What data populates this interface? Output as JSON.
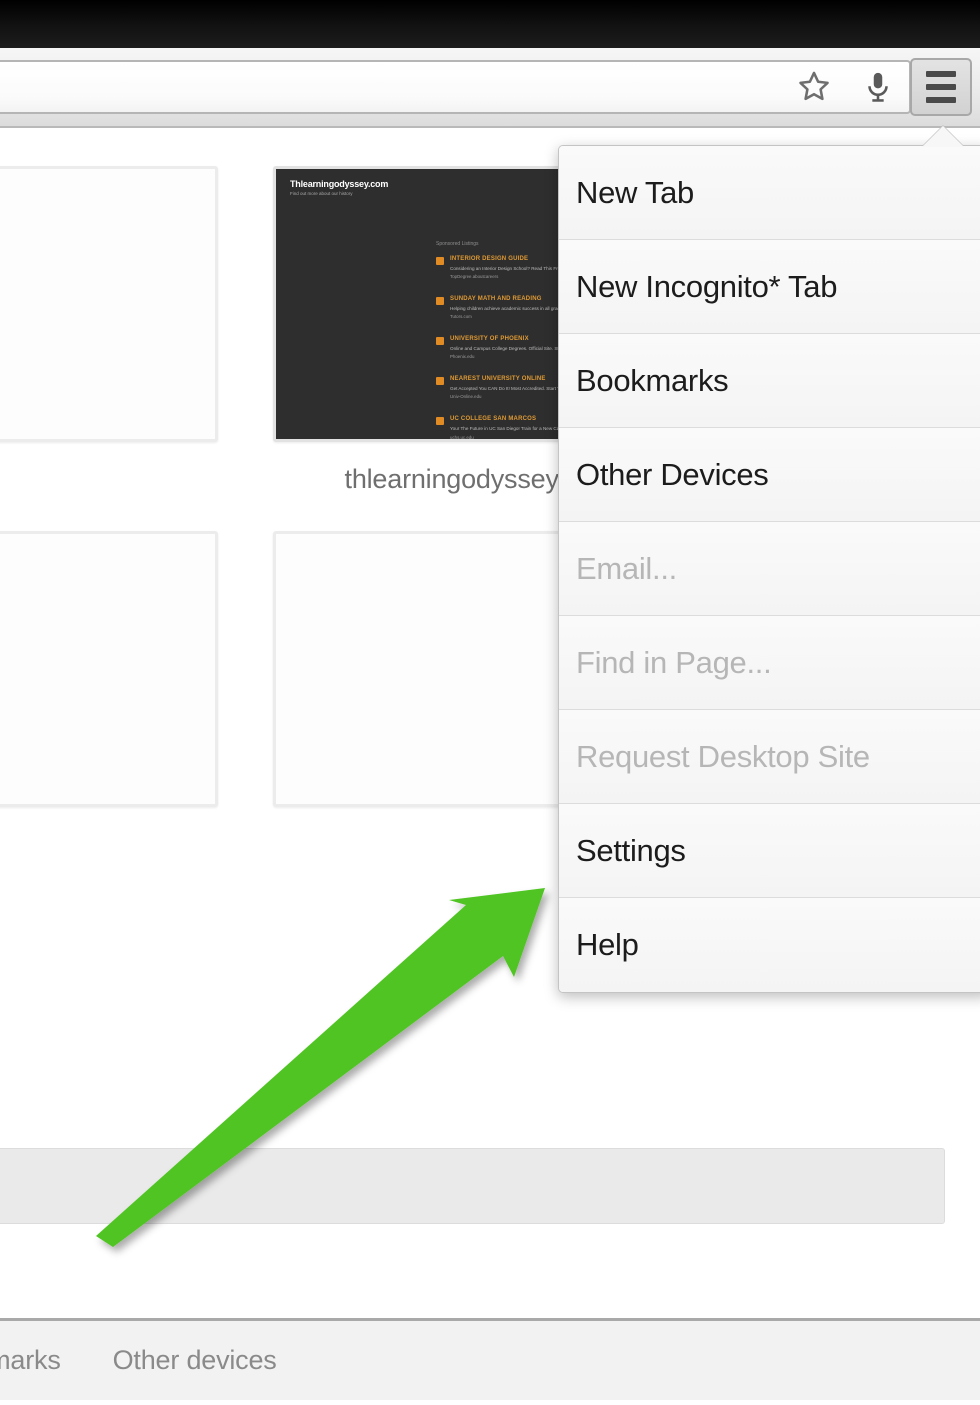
{
  "browser": {
    "toolbar": {
      "omnibox_value": "",
      "omnibox_placeholder": "",
      "bookmark_icon": "star-icon",
      "voice_icon": "microphone-icon",
      "menu_icon": "hamburger-menu-icon"
    }
  },
  "menu": {
    "items": [
      {
        "label": "New Tab",
        "disabled": false
      },
      {
        "label": "New Incognito* Tab",
        "disabled": false
      },
      {
        "label": "Bookmarks",
        "disabled": false
      },
      {
        "label": "Other Devices",
        "disabled": false
      },
      {
        "label": "Email...",
        "disabled": true
      },
      {
        "label": "Find in Page...",
        "disabled": true
      },
      {
        "label": "Request Desktop Site",
        "disabled": true
      },
      {
        "label": "Settings",
        "disabled": false
      },
      {
        "label": "Help",
        "disabled": false
      }
    ]
  },
  "new_tab_page": {
    "thumbnails": [
      {
        "label": "thlearningodyssey.com",
        "kind": "site"
      },
      {
        "label": "",
        "kind": "grey"
      },
      {
        "label": "",
        "kind": "blank"
      },
      {
        "label": "",
        "kind": "blank"
      }
    ],
    "site_preview": {
      "brand": "Thlearningodyssey.com",
      "tagline": "Find out more about our history",
      "ads_heading": "Sponsored Listings",
      "ads": [
        {
          "title": "INTERIOR DESIGN GUIDE",
          "desc": "Considering an Interior Design School? Read This Free Guide First.",
          "url": "TopDegree.aboutcareers"
        },
        {
          "title": "SUNDAY MATH AND READING",
          "desc": "Helping children achieve academic success in all grades. Learn more.",
          "url": "Tutors.com"
        },
        {
          "title": "UNIVERSITY OF PHOENIX",
          "desc": "Online and Campus College Degrees. Official Site. Start Classes Today.",
          "url": "Phoenix.edu"
        },
        {
          "title": "NEAREST UNIVERSITY ONLINE",
          "desc": "Get Accepted You CAN Do It! Most Accredited. Start Your Degree Here.",
          "url": "Univ-Online.edu"
        },
        {
          "title": "UC COLLEGE SAN MARCOS",
          "desc": "Your The Future in UC San Diego! Train for a New Career at UC College.",
          "url": "uchs.uc.edu"
        }
      ]
    }
  },
  "bottom_tabs": {
    "items": [
      {
        "label": "okmarks"
      },
      {
        "label": "Other devices"
      }
    ]
  },
  "annotation": {
    "arrow_color": "#4fc422",
    "arrow_from": "95,1235",
    "arrow_to": "545,890"
  }
}
